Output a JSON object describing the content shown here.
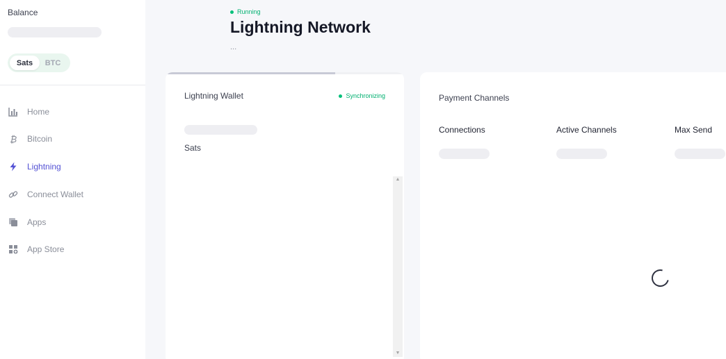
{
  "sidebar": {
    "balance_label": "Balance",
    "unit_toggle": {
      "selected": "Sats",
      "options": [
        "Sats",
        "BTC"
      ]
    },
    "nav": [
      {
        "label": "Home",
        "icon": "bar-chart-icon",
        "active": false
      },
      {
        "label": "Bitcoin",
        "icon": "bitcoin-icon",
        "active": false
      },
      {
        "label": "Lightning",
        "icon": "lightning-bolt-icon",
        "active": true
      },
      {
        "label": "Connect Wallet",
        "icon": "link-icon",
        "active": false
      },
      {
        "label": "Apps",
        "icon": "apps-icon",
        "active": false
      },
      {
        "label": "App Store",
        "icon": "app-store-icon",
        "active": false
      }
    ]
  },
  "header": {
    "status": "Running",
    "title": "Lightning Network",
    "subtitle": "..."
  },
  "wallet_card": {
    "title": "Lightning Wallet",
    "sync_status": "Synchronizing",
    "unit": "Sats",
    "progress_fraction": 0.71
  },
  "channels_card": {
    "title": "Payment Channels",
    "stats": [
      {
        "label": "Connections"
      },
      {
        "label": "Active Channels"
      },
      {
        "label": "Max Send"
      }
    ]
  },
  "colors": {
    "accent": "#5351d4",
    "status_green": "#00c07a",
    "skeleton": "#eeeef2"
  }
}
